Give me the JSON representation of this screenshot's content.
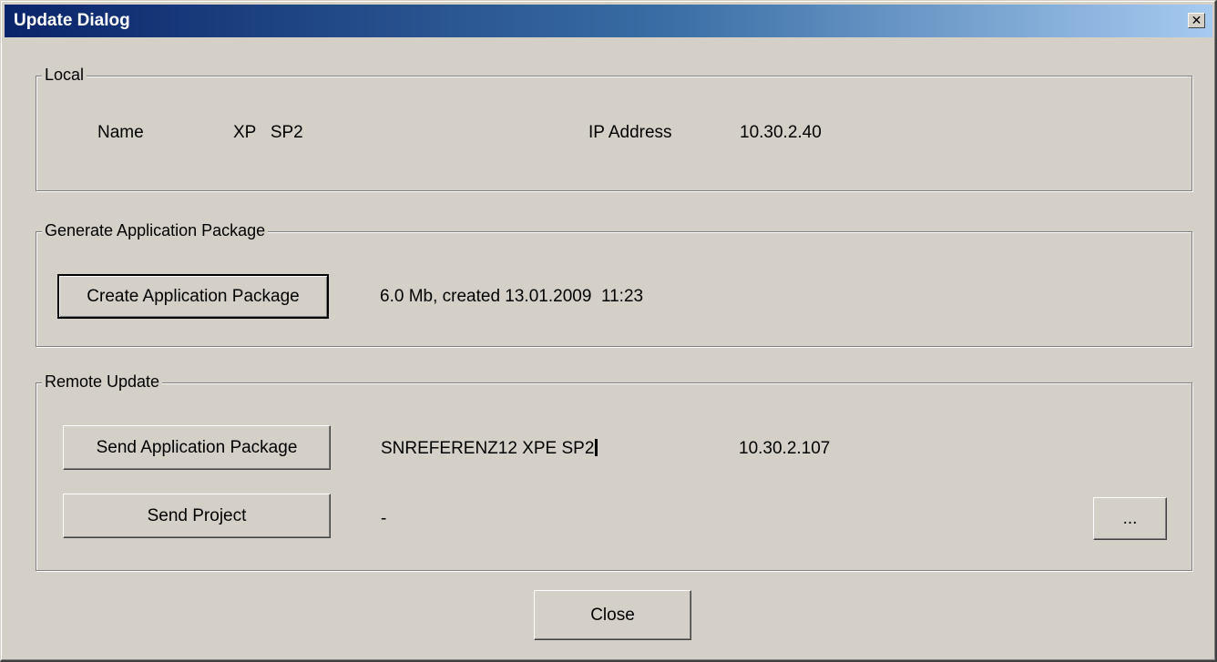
{
  "window": {
    "title": "Update Dialog",
    "close_glyph": "✕"
  },
  "local": {
    "legend": "Local",
    "name_label": "Name",
    "name_value": "XP   SP2",
    "ip_label": "IP Address",
    "ip_value": "10.30.2.40"
  },
  "generate": {
    "legend": "Generate Application Package",
    "create_button_label": "Create Application Package",
    "package_info": "6.0 Mb, created 13.01.2009  11:23"
  },
  "remote": {
    "legend": "Remote Update",
    "send_package_button_label": "Send Application Package",
    "target_name": "SNREFERENZ12 XPE SP2",
    "target_ip": "10.30.2.107",
    "send_project_button_label": "Send Project",
    "project_value": "-",
    "browse_button_label": "..."
  },
  "footer": {
    "close_button_label": "Close"
  },
  "colors": {
    "face": "#d4d0c8",
    "title_start": "#0a246a",
    "title_end": "#a6caf0"
  }
}
